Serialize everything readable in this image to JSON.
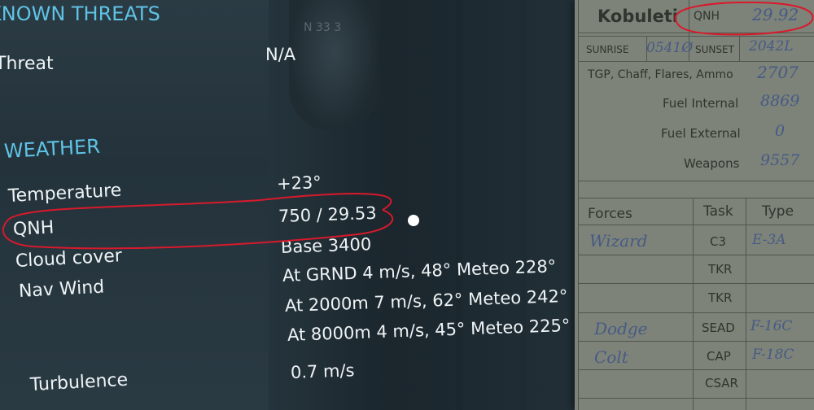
{
  "briefing": {
    "threats_heading": "KNOWN THREATS",
    "threat_label": "Threat",
    "threat_value": "N/A",
    "weather_heading": "WEATHER",
    "temperature_label": "Temperature",
    "temperature_value": "+23°",
    "qnh_label": "QNH",
    "qnh_value": "750 / 29.53",
    "cloud_label": "Cloud cover",
    "cloud_value": "Base 3400",
    "wind_label": "Nav Wind",
    "wind_rows": [
      "At GRND 4 m/s, 48° Meteo 228°",
      "At 2000m 7 m/s, 62° Meteo 242°",
      "At 8000m 4 m/s, 45° Meteo 225°"
    ],
    "turbulence_label": "Turbulence",
    "turbulence_value": "0.7 m/s"
  },
  "compass_digits": "N 33 3",
  "kneeboard": {
    "airfield": "Kobuleti",
    "qnh_label": "QNH",
    "qnh_value": "29.92",
    "sunrise_label": "SUNRISE",
    "sunrise_value": "0541Ø",
    "sunset_label": "SUNSET",
    "sunset_value": "2042L",
    "loadout_label": "TGP, Chaff, Flares, Ammo",
    "loadout_value": "2707",
    "fuel_internal_label": "Fuel Internal",
    "fuel_internal_value": "8869",
    "fuel_external_label": "Fuel External",
    "fuel_external_value": "0",
    "weapons_label": "Weapons",
    "weapons_value": "9557",
    "table_headers": [
      "Forces",
      "Task",
      "Type"
    ],
    "rows": [
      {
        "force": "Wizard",
        "task": "C3",
        "type": "E-3A"
      },
      {
        "force": "",
        "task": "TKR",
        "type": ""
      },
      {
        "force": "",
        "task": "TKR",
        "type": ""
      },
      {
        "force": "Dodge",
        "task": "SEAD",
        "type": "F-16C"
      },
      {
        "force": "Colt",
        "task": "CAP",
        "type": "F-18C"
      },
      {
        "force": "",
        "task": "CSAR",
        "type": ""
      }
    ]
  },
  "colors": {
    "heading": "#5fc3e6",
    "annotation": "#d9192c",
    "kneeboard_paper": "#7d8378",
    "handwriting": "#475a86"
  }
}
